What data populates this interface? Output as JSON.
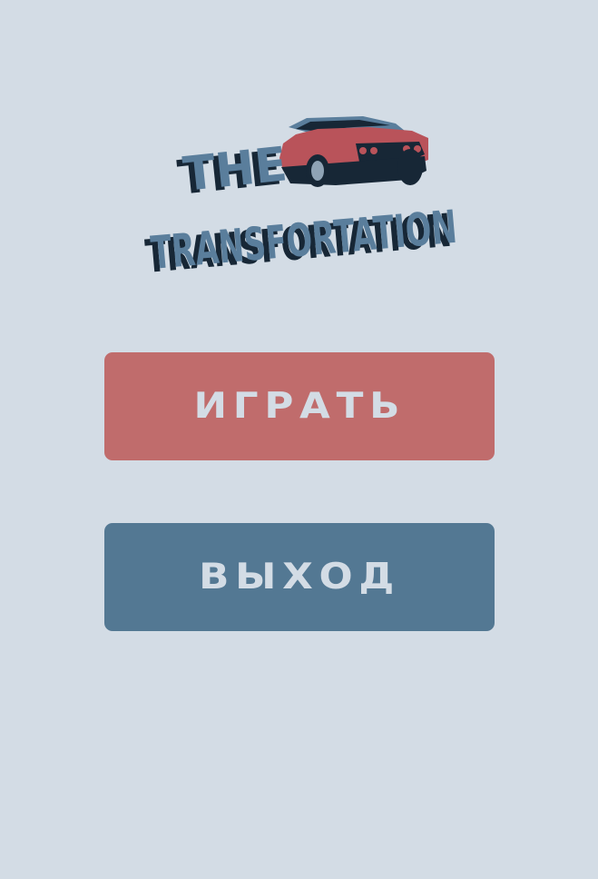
{
  "logo": {
    "line1": "THE",
    "line2": "TRANSFORTATION"
  },
  "menu": {
    "play_label": "ИГРАТЬ",
    "exit_label": "ВЫХОД"
  },
  "colors": {
    "background": "#d3dce5",
    "play_button": "#c06c6c",
    "exit_button": "#537893",
    "logo_text": "#5a7e9c",
    "logo_shadow": "#172736",
    "car_body": "#b9535a"
  }
}
